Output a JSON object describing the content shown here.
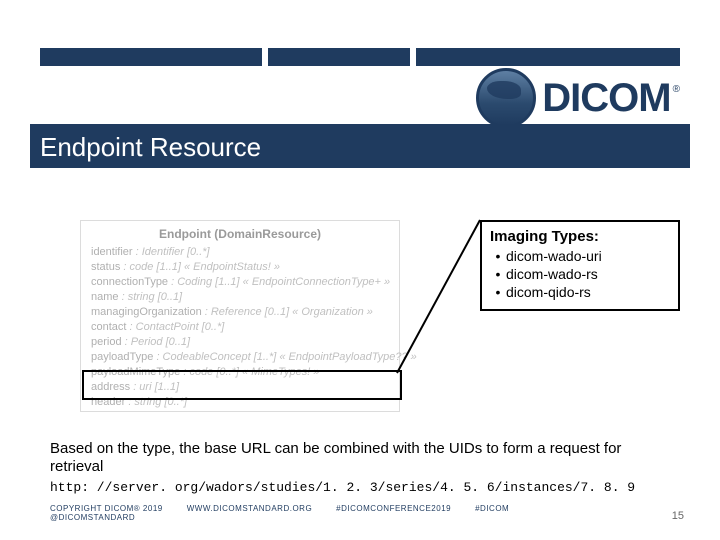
{
  "brand": {
    "name": "DICOM",
    "registered": "®"
  },
  "slide": {
    "title": "Endpoint Resource"
  },
  "diagram": {
    "heading": "Endpoint (DomainResource)",
    "lines": [
      {
        "attr": "identifier",
        "type": ": Identifier [0..*]"
      },
      {
        "attr": "status",
        "type": ": code [1..1] « EndpointStatus! »"
      },
      {
        "attr": "connectionType",
        "type": ": Coding [1..1] « EndpointConnectionType+ »"
      },
      {
        "attr": "name",
        "type": ": string [0..1]"
      },
      {
        "attr": "managingOrganization",
        "type": ": Reference [0..1] « Organization »"
      },
      {
        "attr": "contact",
        "type": ": ContactPoint [0..*]"
      },
      {
        "attr": "period",
        "type": ": Period [0..1]"
      },
      {
        "attr": "payloadType",
        "type": ": CodeableConcept [1..*] « EndpointPayloadType?? »"
      },
      {
        "attr": "payloadMimeType",
        "type": ": code [0..*] « MimeTypes! »"
      },
      {
        "attr": "address",
        "type": ": uri [1..1]"
      },
      {
        "attr": "header",
        "type": ": string [0..*]"
      }
    ]
  },
  "callout": {
    "title": "Imaging Types:",
    "items": [
      "dicom-wado-uri",
      "dicom-wado-rs",
      "dicom-qido-rs"
    ]
  },
  "body": {
    "text": "Based on the type, the base URL can be combined with the UIDs to form a request for retrieval",
    "url": "http: //server. org/wadors/studies/1. 2. 3/series/4. 5. 6/instances/7. 8. 9"
  },
  "footer": {
    "copyright": "COPYRIGHT DICOM® 2019",
    "handle": "@DICOMSTANDARD",
    "url": "WWW.DICOMSTANDARD.ORG",
    "hashtag1": "#DICOMCONFERENCE2019",
    "hashtag2": "#DICOM",
    "page": "15"
  }
}
